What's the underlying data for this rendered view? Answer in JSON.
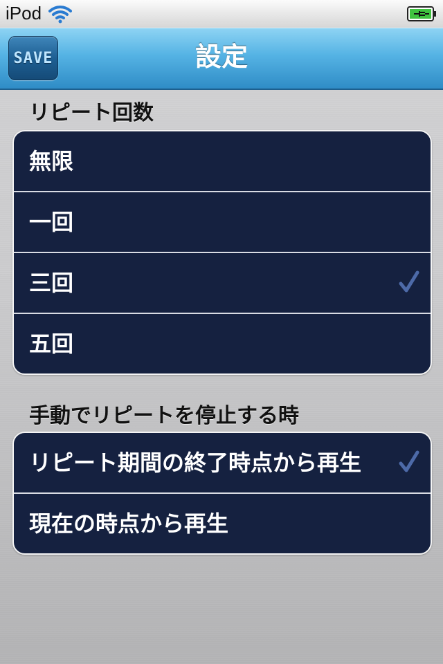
{
  "status_bar": {
    "carrier": "iPod",
    "icons": [
      "wifi-icon",
      "battery-charging-icon"
    ],
    "battery_color": "#3fc23f"
  },
  "nav": {
    "save_label": "SAVE",
    "title": "設定"
  },
  "repeat_count": {
    "header": "リピート回数",
    "options": [
      {
        "label": "無限",
        "checked": false
      },
      {
        "label": "一回",
        "checked": false
      },
      {
        "label": "三回",
        "checked": true
      },
      {
        "label": "五回",
        "checked": false
      }
    ]
  },
  "manual_stop": {
    "header": "手動でリピートを停止する時",
    "options": [
      {
        "label": "リピート期間の終了時点から再生",
        "checked": true
      },
      {
        "label": "現在の時点から再生",
        "checked": false
      }
    ]
  },
  "colors": {
    "nav_accent": "#4aa8dc",
    "cell_background": "#152140",
    "checkmark": "#4d6aa8"
  }
}
